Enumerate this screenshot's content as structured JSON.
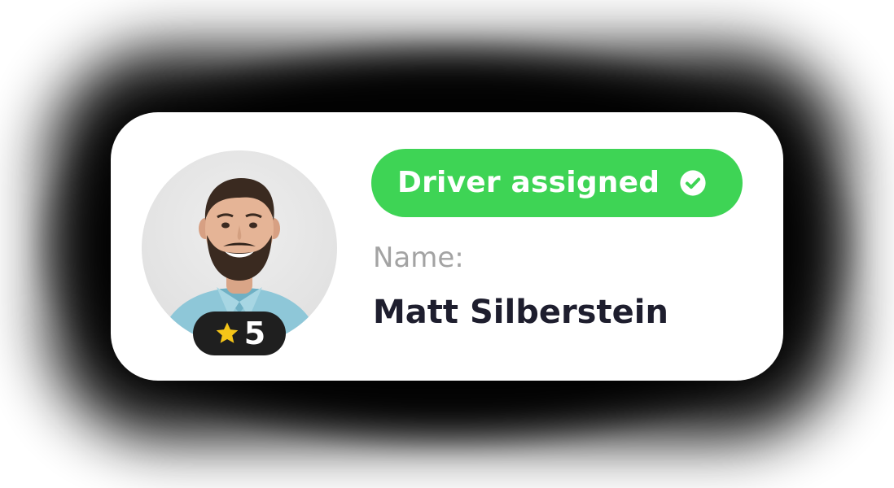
{
  "status_badge": {
    "label": "Driver assigned",
    "icon": "check-circle-icon",
    "color": "#3ed455"
  },
  "driver": {
    "name_label": "Name:",
    "name": "Matt Silberstein",
    "rating": "5",
    "rating_icon": "star-icon"
  },
  "colors": {
    "star": "#f5c518",
    "rating_pill": "#1f1f1f",
    "name_text": "#1e1e2e",
    "label_text": "#a3a3a3"
  }
}
